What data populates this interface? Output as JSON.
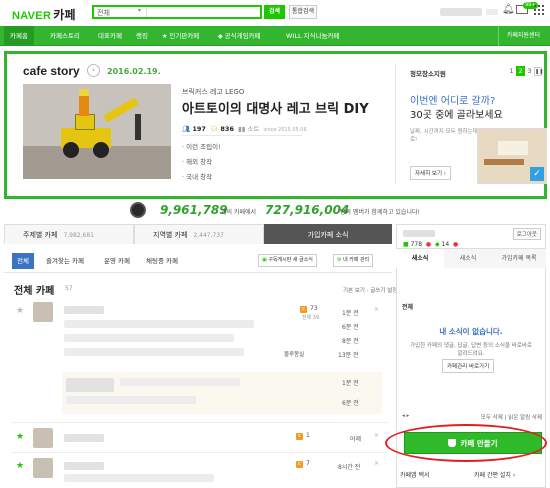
{
  "header": {
    "logo_naver": "NAVER",
    "logo_cafe": "카페",
    "search_scope": "전체",
    "search_button": "검색",
    "total_search": "통합검색",
    "mail_badge": "99+"
  },
  "nav": {
    "items": [
      {
        "label": "카페홈",
        "icon": ""
      },
      {
        "label": "카페스토리",
        "icon": ""
      },
      {
        "label": "대표카페",
        "icon": ""
      },
      {
        "label": "랭킹",
        "icon": ""
      },
      {
        "label": "인기판카페",
        "icon": "★"
      },
      {
        "label": "공식게임카페",
        "icon": "◆"
      },
      {
        "label": "WILL 지식나눔카페",
        "icon": ""
      }
    ],
    "support_center": "카페지원센터"
  },
  "banner": {
    "title": "cafe story",
    "date": "2016.02.19.",
    "subtitle": "브릭커스 레고 LEGO",
    "headline": "아트토이의 대명사 레고 브릭 DIY",
    "members": "197",
    "posts": "836",
    "level_label": "소트",
    "since": "since 2015.05.06.",
    "bullets": [
      "· 이런 조립이!",
      "· 해외 창작",
      "· 국내 창작"
    ],
    "info": {
      "title": "정모장소지원",
      "pages": [
        "1",
        "2",
        "3"
      ],
      "question": "이번엔 어디로 갈까?",
      "answer": "30곳 중에 골라보세요",
      "small_text": "날짜, 시간까지 모두 원하는대로!",
      "detail_button": "자세히 보기 ›"
    }
  },
  "counter": {
    "cafes": "9,961,789",
    "cafes_label": "개의 카페에서",
    "members": "727,916,004",
    "members_label": "명의 멤버가 함께하고 있습니다!"
  },
  "main_tabs": [
    {
      "label": "주제별 카페",
      "count": "7,982,681"
    },
    {
      "label": "지역별 카페",
      "count": "2,447,737"
    },
    {
      "label": "가입카페 소식",
      "count": ""
    }
  ],
  "sub_tabs": [
    "전체",
    "즐겨찾는 카페",
    "운영 카페",
    "채팅중 카페"
  ],
  "sub_buttons": {
    "subscribe": "구독게시판 새 글소식",
    "manage": "내 카페 관리"
  },
  "all_cafe": {
    "title": "전체 카페",
    "count": "57",
    "sort": "기본 보기 · 글쓰기 설정"
  },
  "feed": {
    "row1": {
      "count": "73",
      "sub_count": "전체 39",
      "times": [
        "1분 전",
        "6분 전",
        "8분 전",
        "13분 전"
      ],
      "tag": "블루몽실"
    },
    "quote_times": [
      "1분 전",
      "6분 전"
    ],
    "row2": {
      "count": "1",
      "time": "어제"
    },
    "row3": {
      "count": "7",
      "time": "8시간 전"
    }
  },
  "sidebar": {
    "logout": "로그아웃",
    "stat1": "778",
    "stat2": "14",
    "tabs": [
      "새소식",
      "새소식",
      "가입카페 목록"
    ],
    "all_label": "전체",
    "no_news": "내 소식이 없습니다.",
    "no_news_desc": "가입한 카페의 댓글, 답글, 답변 등의 소식을 바로바로 알려드려요.",
    "manage_button": "카페관리 바로가기",
    "footer_right": "모두 삭제 | 읽은 알림 삭제",
    "make_button": "카페 만들기",
    "bottom_left": "카페앱 백서",
    "bottom_right": "카페 간편 설치 ›"
  },
  "colors": {
    "naver_green": "#1ec800",
    "nav_green": "#33b530",
    "accent_blue": "#3a72c4",
    "highlight_red": "#e02020"
  }
}
